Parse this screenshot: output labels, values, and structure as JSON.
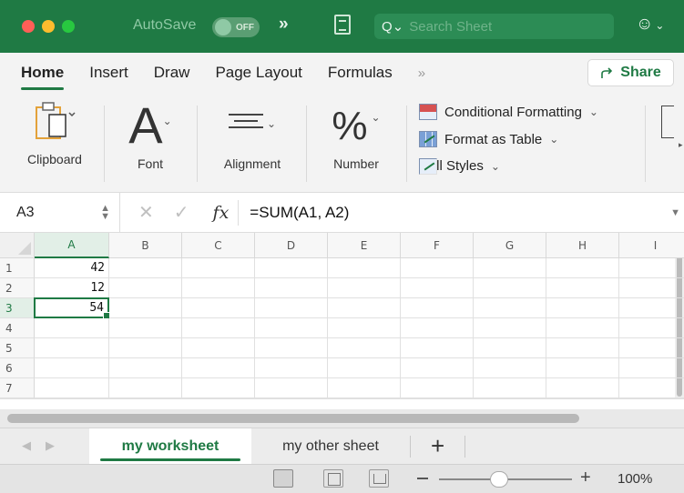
{
  "titlebar": {
    "autosave_label": "AutoSave",
    "autosave_state": "OFF",
    "search_placeholder": "Search Sheet",
    "search_icon": "magnifier-icon",
    "overflow_glyph": "»",
    "account_glyph": "☺",
    "account_caret": "⌄"
  },
  "ribbon_tabs": {
    "home": "Home",
    "insert": "Insert",
    "draw": "Draw",
    "page_layout": "Page Layout",
    "formulas": "Formulas",
    "more": "»",
    "share": "Share"
  },
  "ribbon": {
    "clipboard": "Clipboard",
    "font": "Font",
    "font_glyph": "A",
    "alignment": "Alignment",
    "number": "Number",
    "number_glyph": "%",
    "conditional_formatting": "Conditional Formatting",
    "format_as_table": "Format as Table",
    "cell_styles": "Cell Styles",
    "caret": "⌄"
  },
  "formula_bar": {
    "name_box": "A3",
    "fx": "fx",
    "formula": "=SUM(A1, A2)"
  },
  "grid": {
    "columns": [
      "A",
      "B",
      "C",
      "D",
      "E",
      "F",
      "G",
      "H",
      "I"
    ],
    "rows": [
      "1",
      "2",
      "3",
      "4",
      "5",
      "6",
      "7"
    ],
    "selected_column": "A",
    "selected_row": "3",
    "cells": {
      "A1": "42",
      "A2": "12",
      "A3": "54"
    }
  },
  "sheets": {
    "tabs": [
      "my worksheet",
      "my other sheet"
    ],
    "active": "my worksheet",
    "add": "+"
  },
  "status": {
    "zoom": "100%"
  },
  "colors": {
    "accent": "#1f7a44",
    "title_bar": "#1f7a44"
  }
}
